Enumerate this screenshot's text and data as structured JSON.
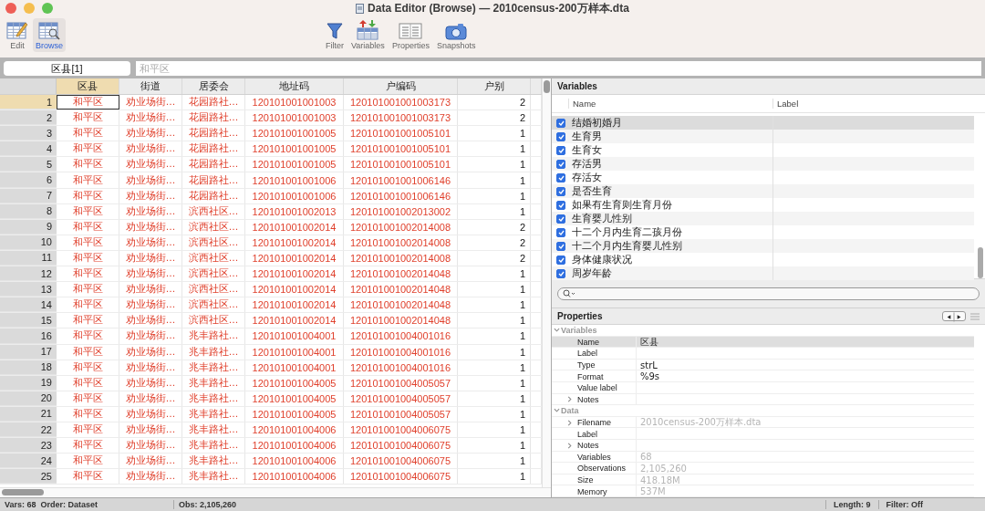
{
  "window": {
    "title": "Data Editor (Browse) — 2010census-200万样本.dta"
  },
  "toolbar": {
    "left": [
      {
        "kind": "edit",
        "label": "Edit",
        "selected": false
      },
      {
        "kind": "browse",
        "label": "Browse",
        "selected": true
      }
    ],
    "right": [
      {
        "kind": "filter",
        "label": "Filter"
      },
      {
        "kind": "variables",
        "label": "Variables"
      },
      {
        "kind": "properties",
        "label": "Properties"
      },
      {
        "kind": "snapshots",
        "label": "Snapshots"
      }
    ]
  },
  "field_bar": {
    "cell_name": "区县[1]",
    "value": "和平区",
    "disabled": true
  },
  "grid": {
    "columns": [
      {
        "label": "区县",
        "selected": true
      },
      {
        "label": "街道",
        "selected": false
      },
      {
        "label": "居委会",
        "selected": false
      },
      {
        "label": "地址码",
        "selected": false
      },
      {
        "label": "户编码",
        "selected": false
      },
      {
        "label": "户别",
        "selected": false
      }
    ],
    "rows": [
      {
        "number": "1",
        "selected": true,
        "cells": [
          "和平区",
          "劝业场街…",
          "花园路社…",
          "120101001001003",
          "120101001001003173",
          "2"
        ]
      },
      {
        "number": "2",
        "selected": false,
        "cells": [
          "和平区",
          "劝业场街…",
          "花园路社…",
          "120101001001003",
          "120101001001003173",
          "2"
        ]
      },
      {
        "number": "3",
        "selected": false,
        "cells": [
          "和平区",
          "劝业场街…",
          "花园路社…",
          "120101001001005",
          "120101001001005101",
          "1"
        ]
      },
      {
        "number": "4",
        "selected": false,
        "cells": [
          "和平区",
          "劝业场街…",
          "花园路社…",
          "120101001001005",
          "120101001001005101",
          "1"
        ]
      },
      {
        "number": "5",
        "selected": false,
        "cells": [
          "和平区",
          "劝业场街…",
          "花园路社…",
          "120101001001005",
          "120101001001005101",
          "1"
        ]
      },
      {
        "number": "6",
        "selected": false,
        "cells": [
          "和平区",
          "劝业场街…",
          "花园路社…",
          "120101001001006",
          "120101001001006146",
          "1"
        ]
      },
      {
        "number": "7",
        "selected": false,
        "cells": [
          "和平区",
          "劝业场街…",
          "花园路社…",
          "120101001001006",
          "120101001001006146",
          "1"
        ]
      },
      {
        "number": "8",
        "selected": false,
        "cells": [
          "和平区",
          "劝业场街…",
          "滨西社区…",
          "120101001002013",
          "120101001002013002",
          "1"
        ]
      },
      {
        "number": "9",
        "selected": false,
        "cells": [
          "和平区",
          "劝业场街…",
          "滨西社区…",
          "120101001002014",
          "120101001002014008",
          "2"
        ]
      },
      {
        "number": "10",
        "selected": false,
        "cells": [
          "和平区",
          "劝业场街…",
          "滨西社区…",
          "120101001002014",
          "120101001002014008",
          "2"
        ]
      },
      {
        "number": "11",
        "selected": false,
        "cells": [
          "和平区",
          "劝业场街…",
          "滨西社区…",
          "120101001002014",
          "120101001002014008",
          "2"
        ]
      },
      {
        "number": "12",
        "selected": false,
        "cells": [
          "和平区",
          "劝业场街…",
          "滨西社区…",
          "120101001002014",
          "120101001002014048",
          "1"
        ]
      },
      {
        "number": "13",
        "selected": false,
        "cells": [
          "和平区",
          "劝业场街…",
          "滨西社区…",
          "120101001002014",
          "120101001002014048",
          "1"
        ]
      },
      {
        "number": "14",
        "selected": false,
        "cells": [
          "和平区",
          "劝业场街…",
          "滨西社区…",
          "120101001002014",
          "120101001002014048",
          "1"
        ]
      },
      {
        "number": "15",
        "selected": false,
        "cells": [
          "和平区",
          "劝业场街…",
          "滨西社区…",
          "120101001002014",
          "120101001002014048",
          "1"
        ]
      },
      {
        "number": "16",
        "selected": false,
        "cells": [
          "和平区",
          "劝业场街…",
          "兆丰路社…",
          "120101001004001",
          "120101001004001016",
          "1"
        ]
      },
      {
        "number": "17",
        "selected": false,
        "cells": [
          "和平区",
          "劝业场街…",
          "兆丰路社…",
          "120101001004001",
          "120101001004001016",
          "1"
        ]
      },
      {
        "number": "18",
        "selected": false,
        "cells": [
          "和平区",
          "劝业场街…",
          "兆丰路社…",
          "120101001004001",
          "120101001004001016",
          "1"
        ]
      },
      {
        "number": "19",
        "selected": false,
        "cells": [
          "和平区",
          "劝业场街…",
          "兆丰路社…",
          "120101001004005",
          "120101001004005057",
          "1"
        ]
      },
      {
        "number": "20",
        "selected": false,
        "cells": [
          "和平区",
          "劝业场街…",
          "兆丰路社…",
          "120101001004005",
          "120101001004005057",
          "1"
        ]
      },
      {
        "number": "21",
        "selected": false,
        "cells": [
          "和平区",
          "劝业场街…",
          "兆丰路社…",
          "120101001004005",
          "120101001004005057",
          "1"
        ]
      },
      {
        "number": "22",
        "selected": false,
        "cells": [
          "和平区",
          "劝业场街…",
          "兆丰路社…",
          "120101001004006",
          "120101001004006075",
          "1"
        ]
      },
      {
        "number": "23",
        "selected": false,
        "cells": [
          "和平区",
          "劝业场街…",
          "兆丰路社…",
          "120101001004006",
          "120101001004006075",
          "1"
        ]
      },
      {
        "number": "24",
        "selected": false,
        "cells": [
          "和平区",
          "劝业场街…",
          "兆丰路社…",
          "120101001004006",
          "120101001004006075",
          "1"
        ]
      },
      {
        "number": "25",
        "selected": false,
        "cells": [
          "和平区",
          "劝业场街…",
          "兆丰路社…",
          "120101001004006",
          "120101001004006075",
          "1"
        ]
      }
    ]
  },
  "variables": {
    "title": "Variables",
    "columns": [
      "Name",
      "Label"
    ],
    "rows": [
      {
        "name": "结婚初婚月",
        "checked": true,
        "selected": true
      },
      {
        "name": "生育男",
        "checked": true,
        "selected": false
      },
      {
        "name": "生育女",
        "checked": true,
        "selected": false
      },
      {
        "name": "存活男",
        "checked": true,
        "selected": false
      },
      {
        "name": "存活女",
        "checked": true,
        "selected": false
      },
      {
        "name": "是否生育",
        "checked": true,
        "selected": false
      },
      {
        "name": "如果有生育则生育月份",
        "checked": true,
        "selected": false
      },
      {
        "name": "生育婴儿性别",
        "checked": true,
        "selected": false
      },
      {
        "name": "十二个月内生育二孩月份",
        "checked": true,
        "selected": false
      },
      {
        "name": "十二个月内生育婴儿性别",
        "checked": true,
        "selected": false
      },
      {
        "name": "身体健康状况",
        "checked": true,
        "selected": false
      },
      {
        "name": "周岁年龄",
        "checked": true,
        "selected": false
      }
    ]
  },
  "properties": {
    "title": "Properties",
    "groups": [
      {
        "label": "Variables",
        "expanded": true,
        "disabled": false,
        "items": [
          {
            "name": "Name",
            "value": "区县",
            "selected": true,
            "kind": "plain"
          },
          {
            "name": "Label",
            "selected": false,
            "kind": "plain"
          },
          {
            "name": "Type",
            "value": "strL",
            "selected": false,
            "kind": "plain"
          },
          {
            "name": "Format",
            "value": "%9s",
            "selected": false,
            "kind": "plain"
          },
          {
            "name": "Value label",
            "selected": false,
            "kind": "plain"
          },
          {
            "name": "Notes",
            "selected": false,
            "kind": "toggle",
            "expanded": false
          }
        ]
      },
      {
        "label": "Data",
        "expanded": true,
        "disabled": true,
        "items": [
          {
            "name": "Filename",
            "value": "2010census-200万样本.dta",
            "selected": false,
            "kind": "toggle",
            "expanded": false
          },
          {
            "name": "Label",
            "selected": false,
            "kind": "plain"
          },
          {
            "name": "Notes",
            "selected": false,
            "kind": "toggle",
            "expanded": false
          },
          {
            "name": "Variables",
            "value": "68",
            "selected": false,
            "kind": "plain"
          },
          {
            "name": "Observations",
            "value": "2,105,260",
            "selected": false,
            "kind": "plain"
          },
          {
            "name": "Size",
            "value": "418.18M",
            "selected": false,
            "kind": "plain"
          },
          {
            "name": "Memory",
            "value": "537M",
            "selected": false,
            "kind": "plain"
          }
        ]
      }
    ]
  },
  "status_bar": {
    "left": [
      "Vars: 68  Order: Dataset",
      "Obs: 2,105,260"
    ],
    "right": [
      "Length: 9",
      "Filter: Off"
    ]
  }
}
